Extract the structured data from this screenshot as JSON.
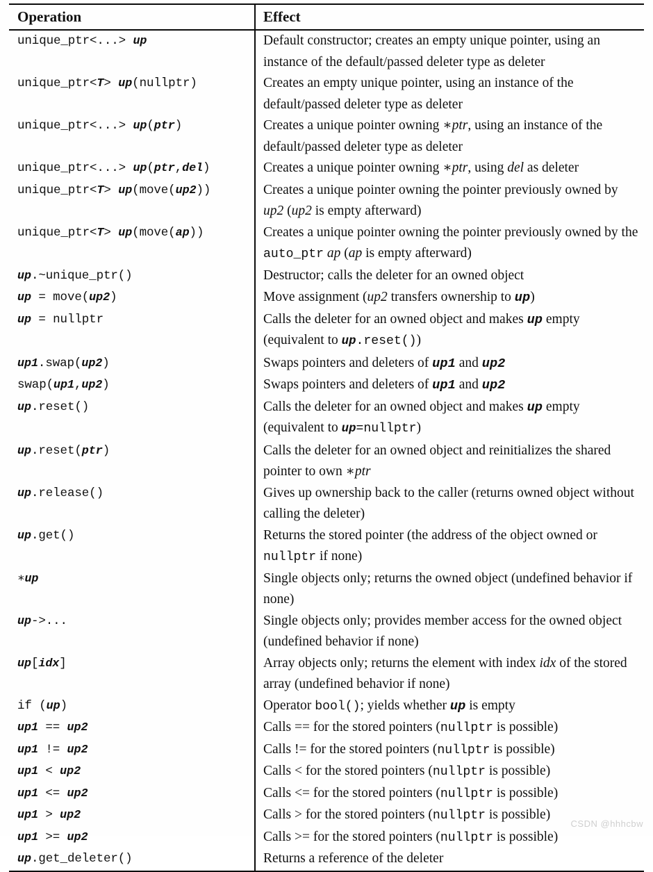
{
  "document": {
    "kind": "reference-table",
    "watermark": "CSDN @hhhcbw"
  },
  "table": {
    "columns": [
      {
        "key": "operation",
        "label": "Operation"
      },
      {
        "key": "effect",
        "label": "Effect"
      }
    ],
    "rows": [
      {
        "operation": "unique_ptr<...> up",
        "operation_html": "unique_ptr&lt;...&gt; <span class=\"varm\">up</span>",
        "effect": "Default constructor; creates an empty unique pointer, using an instance of the default/passed deleter type as deleter",
        "effect_html": "Default constructor; creates an empty unique pointer, using an instance of the default/passed deleter type as deleter"
      },
      {
        "operation": "unique_ptr<T> up(nullptr)",
        "operation_html": "unique_ptr&lt;<span class=\"varm\">T</span>&gt; <span class=\"varm\">up</span>(nullptr)",
        "effect": "Creates an empty unique pointer, using an instance of the default/passed deleter type as deleter",
        "effect_html": "Creates an empty unique pointer, using an instance of the default/passed deleter type as deleter"
      },
      {
        "operation": "unique_ptr<...> up(ptr)",
        "operation_html": "unique_ptr&lt;...&gt; <span class=\"varm\">up</span>(<span class=\"varm\">ptr</span>)",
        "effect": "Creates a unique pointer owning *ptr, using an instance of the default/passed deleter type as deleter",
        "effect_html": "Creates a unique pointer owning <span class=\"ital\">∗ptr</span>, using an instance of the default/passed deleter type as deleter"
      },
      {
        "operation": "unique_ptr<...> up(ptr,del)",
        "operation_html": "unique_ptr&lt;...&gt; <span class=\"varm\">up</span>(<span class=\"varm\">ptr</span>,<span class=\"varm\">del</span>)",
        "effect": "Creates a unique pointer owning *ptr, using del as deleter",
        "effect_html": "Creates a unique pointer owning <span class=\"ital\">∗ptr</span>, using <span class=\"ital\">del</span> as deleter"
      },
      {
        "operation": "unique_ptr<T> up(move(up2))",
        "operation_html": "unique_ptr&lt;<span class=\"varm\">T</span>&gt; <span class=\"varm\">up</span>(move(<span class=\"varm\">up2</span>))",
        "effect": "Creates a unique pointer owning the pointer previously owned by up2 (up2 is empty afterward)",
        "effect_html": "Creates a unique pointer owning the pointer previously owned by <span class=\"ital\">up2</span> (<span class=\"ital\">up2</span> is empty afterward)"
      },
      {
        "operation": "unique_ptr<T> up(move(ap))",
        "operation_html": "unique_ptr&lt;<span class=\"varm\">T</span>&gt; <span class=\"varm\">up</span>(move(<span class=\"varm\">ap</span>))",
        "effect": "Creates a unique pointer owning the pointer previously owned by the auto_ptr ap (ap is empty afterward)",
        "effect_html": "Creates a unique pointer owning the pointer previously owned by the <span class=\"mono\">auto_ptr</span> <span class=\"ital\">ap</span> (<span class=\"ital\">ap</span> is empty afterward)"
      },
      {
        "operation": "up.~unique_ptr()",
        "operation_html": "<span class=\"varm\">up</span>.~unique_ptr()",
        "effect": "Destructor; calls the deleter for an owned object",
        "effect_html": "Destructor; calls the deleter for an owned object"
      },
      {
        "operation": "up = move(up2)",
        "operation_html": "<span class=\"varm\">up</span> = move(<span class=\"varm\">up2</span>)",
        "effect": "Move assignment (up2 transfers ownership to up)",
        "effect_html": "Move assignment (<span class=\"ital\">up2</span> transfers ownership to <span class=\"varm\">up</span>)"
      },
      {
        "operation": "up = nullptr",
        "operation_html": "<span class=\"varm\">up</span> = nullptr",
        "effect": "Calls the deleter for an owned object and makes up empty (equivalent to up.reset())",
        "effect_html": "Calls the deleter for an owned object and makes <span class=\"varm\">up</span> empty (equivalent to <span class=\"mono\"><span class=\"varm\">up</span>.reset()</span>)"
      },
      {
        "operation": "up1.swap(up2)",
        "operation_html": "<span class=\"varm\">up1</span>.swap(<span class=\"varm\">up2</span>)",
        "effect": "Swaps pointers and deleters of up1 and up2",
        "effect_html": "Swaps pointers and deleters of <span class=\"varm\">up1</span> and <span class=\"varm\">up2</span>"
      },
      {
        "operation": "swap(up1,up2)",
        "operation_html": "swap(<span class=\"varm\">up1</span>,<span class=\"varm\">up2</span>)",
        "effect": "Swaps pointers and deleters of up1 and up2",
        "effect_html": "Swaps pointers and deleters of <span class=\"varm\">up1</span> and <span class=\"varm\">up2</span>"
      },
      {
        "operation": "up.reset()",
        "operation_html": "<span class=\"varm\">up</span>.reset()",
        "effect": "Calls the deleter for an owned object and makes up empty (equivalent to up=nullptr)",
        "effect_html": "Calls the deleter for an owned object and makes <span class=\"varm\">up</span> empty (equivalent to <span class=\"mono\"><span class=\"varm\">up</span>=nullptr</span>)"
      },
      {
        "operation": "up.reset(ptr)",
        "operation_html": "<span class=\"varm\">up</span>.reset(<span class=\"varm\">ptr</span>)",
        "effect": "Calls the deleter for an owned object and reinitializes the shared pointer to own *ptr",
        "effect_html": "Calls the deleter for an owned object and reinitializes the shared pointer to own <span class=\"ital\">∗ptr</span>"
      },
      {
        "operation": "up.release()",
        "operation_html": "<span class=\"varm\">up</span>.release()",
        "effect": "Gives up ownership back to the caller (returns owned object without calling the deleter)",
        "effect_html": "Gives up ownership back to the caller (returns owned object without calling the deleter)"
      },
      {
        "operation": "up.get()",
        "operation_html": "<span class=\"varm\">up</span>.get()",
        "effect": "Returns the stored pointer (the address of the object owned or nullptr if none)",
        "effect_html": "Returns the stored pointer (the address of the object owned or <span class=\"mono\">nullptr</span> if none)"
      },
      {
        "operation": "*up",
        "operation_html": "∗<span class=\"varm\">up</span>",
        "effect": "Single objects only; returns the owned object (undefined behavior if none)",
        "effect_html": "Single objects only; returns the owned object (undefined behavior if none)"
      },
      {
        "operation": "up->...",
        "operation_html": "<span class=\"varm\">up</span>-&gt;...",
        "effect": "Single objects only; provides member access for the owned object (undefined behavior if none)",
        "effect_html": "Single objects only; provides member access for the owned object (undefined behavior if none)"
      },
      {
        "operation": "up[idx]",
        "operation_html": "<span class=\"varm\">up</span>[<span class=\"varm\">idx</span>]",
        "effect": "Array objects only; returns the element with index idx of the stored array (undefined behavior if none)",
        "effect_html": "Array objects only; returns the element with index <span class=\"ital\">idx</span> of the stored array (undefined behavior if none)"
      },
      {
        "operation": "if (up)",
        "operation_html": "if (<span class=\"varm\">up</span>)",
        "effect": "Operator bool(); yields whether up is empty",
        "effect_html": "Operator <span class=\"mono\">bool()</span>; yields whether <span class=\"varm\">up</span> is empty"
      },
      {
        "operation": "up1 == up2",
        "operation_html": "<span class=\"varm\">up1</span> == <span class=\"varm\">up2</span>",
        "effect": "Calls == for the stored pointers (nullptr is possible)",
        "effect_html": "Calls == for the stored pointers (<span class=\"mono\">nullptr</span> is possible)"
      },
      {
        "operation": "up1 != up2",
        "operation_html": "<span class=\"varm\">up1</span> != <span class=\"varm\">up2</span>",
        "effect": "Calls != for the stored pointers (nullptr is possible)",
        "effect_html": "Calls != for the stored pointers (<span class=\"mono\">nullptr</span> is possible)"
      },
      {
        "operation": "up1 < up2",
        "operation_html": "<span class=\"varm\">up1</span> &lt; <span class=\"varm\">up2</span>",
        "effect": "Calls < for the stored pointers (nullptr is possible)",
        "effect_html": "Calls &lt; for the stored pointers (<span class=\"mono\">nullptr</span> is possible)"
      },
      {
        "operation": "up1 <= up2",
        "operation_html": "<span class=\"varm\">up1</span> &lt;= <span class=\"varm\">up2</span>",
        "effect": "Calls <= for the stored pointers (nullptr is possible)",
        "effect_html": "Calls &lt;= for the stored pointers (<span class=\"mono\">nullptr</span> is possible)"
      },
      {
        "operation": "up1 > up2",
        "operation_html": "<span class=\"varm\">up1</span> &gt; <span class=\"varm\">up2</span>",
        "effect": "Calls > for the stored pointers (nullptr is possible)",
        "effect_html": "Calls &gt; for the stored pointers (<span class=\"mono\">nullptr</span> is possible)"
      },
      {
        "operation": "up1 >= up2",
        "operation_html": "<span class=\"varm\">up1</span> &gt;= <span class=\"varm\">up2</span>",
        "effect": "Calls >= for the stored pointers (nullptr is possible)",
        "effect_html": "Calls &gt;= for the stored pointers (<span class=\"mono\">nullptr</span> is possible)"
      },
      {
        "operation": "up.get_deleter()",
        "operation_html": "<span class=\"varm\">up</span>.get_deleter()",
        "effect": "Returns a reference of the deleter",
        "effect_html": "Returns a reference of the deleter"
      }
    ]
  },
  "colors": {
    "rule": "#0b0b0b",
    "text": "#101010",
    "page": "#fefefe",
    "watermark": "#cfcfcf"
  }
}
